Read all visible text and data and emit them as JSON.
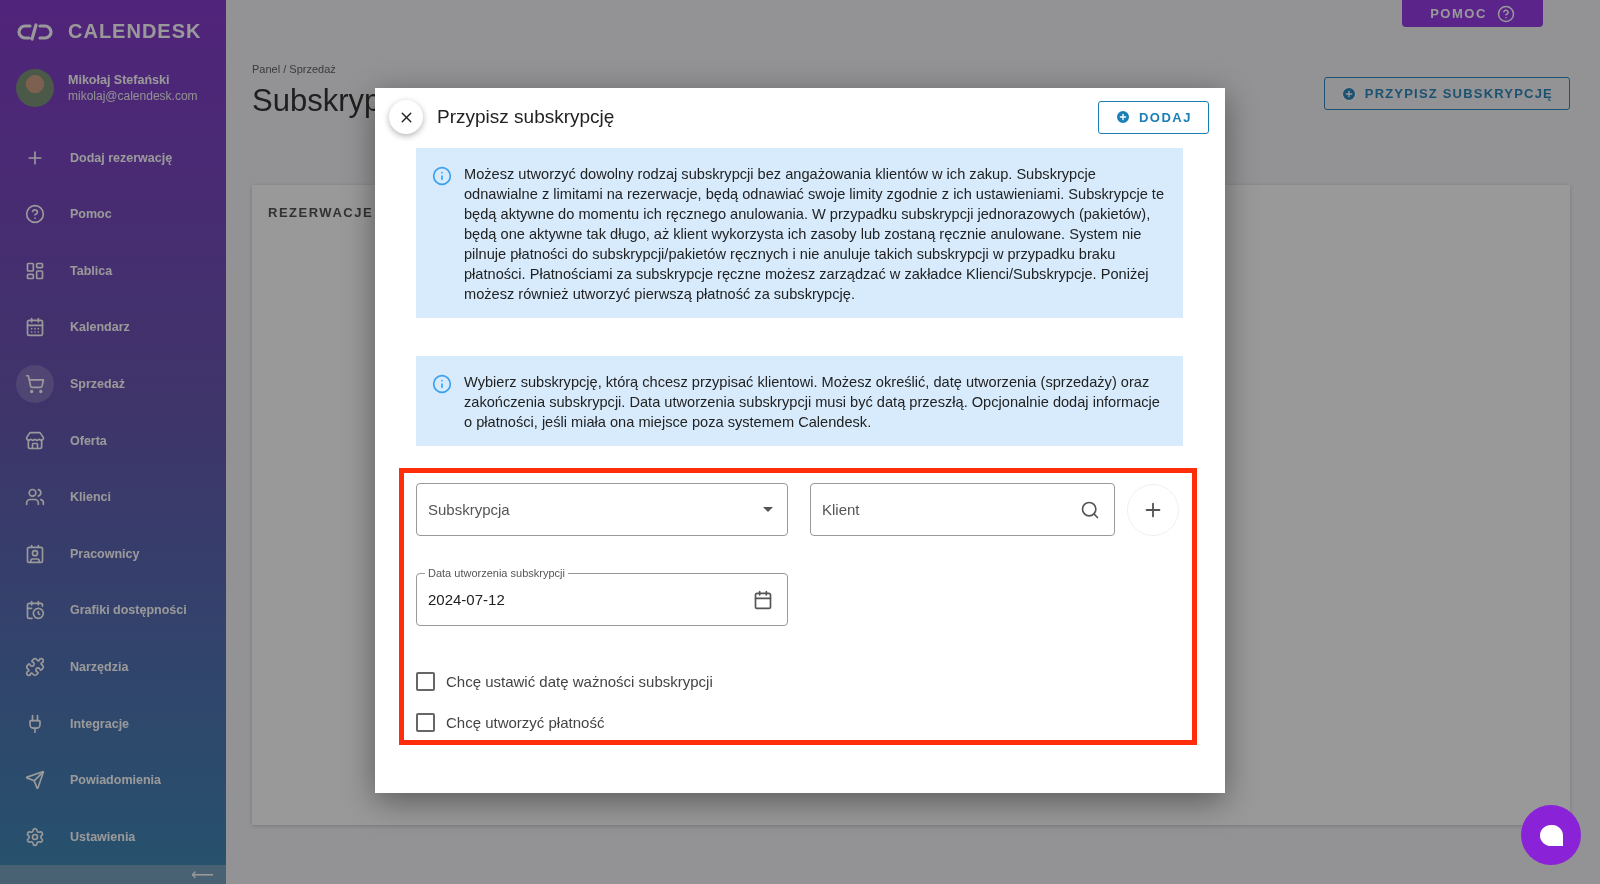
{
  "brand": "CALENDESK",
  "user": {
    "name": "Mikołaj Stefański",
    "email": "mikolaj@calendesk.com"
  },
  "sidebar": {
    "items": [
      {
        "label": "Dodaj rezerwację",
        "selected": false
      },
      {
        "label": "Pomoc",
        "selected": false
      },
      {
        "label": "Tablica",
        "selected": false
      },
      {
        "label": "Kalendarz",
        "selected": false
      },
      {
        "label": "Sprzedaż",
        "selected": true
      },
      {
        "label": "Oferta",
        "selected": false
      },
      {
        "label": "Klienci",
        "selected": false
      },
      {
        "label": "Pracownicy",
        "selected": false
      },
      {
        "label": "Grafiki dostępności",
        "selected": false
      },
      {
        "label": "Narzędzia",
        "selected": false
      },
      {
        "label": "Integracje",
        "selected": false
      },
      {
        "label": "Powiadomienia",
        "selected": false
      },
      {
        "label": "Ustawienia",
        "selected": false
      }
    ],
    "collapse": "⟵"
  },
  "help_button": "POMOC",
  "breadcrumb": "Panel / Sprzedaż",
  "page_title": "Subskryp",
  "assign_button": "PRZYPISZ SUBSKRYPCJĘ",
  "card_title": "REZERWACJE",
  "dialog": {
    "title": "Przypisz subskrypcję",
    "add_button": "DODAJ",
    "infos": [
      "Możesz utworzyć dowolny rodzaj subskrypcji bez angażowania klientów w ich zakup. Subskrypcje odnawialne z limitami na rezerwacje, będą odnawiać swoje limity zgodnie z ich ustawieniami. Subskrypcje te będą aktywne do momentu ich ręcznego anulowania. W przypadku subskrypcji jednorazowych (pakietów), będą one aktywne tak długo, aż klient wykorzysta ich zasoby lub zostaną ręcznie anulowane. System nie pilnuje płatności do subskrypcji/pakietów ręcznych i nie anuluje takich subskrypcji w przypadku braku płatności. Płatnościami za subskrypcje ręczne możesz zarządzać w zakładce Klienci/Subskrypcje. Poniżej możesz również utworzyć pierwszą płatność za subskrypcję.",
      "Wybierz subskrypcję, którą chcesz przypisać klientowi. Możesz określić, datę utworzenia (sprzedaży) oraz zakończenia subskrypcji. Data utworzenia subskrypcji musi być datą przeszłą. Opcjonalnie dodaj informacje o płatności, jeśli miała ona miejsce poza systemem Calendesk."
    ],
    "subscription": {
      "placeholder": "Subskrypcja"
    },
    "client": {
      "placeholder": "Klient"
    },
    "created_date": {
      "label": "Data utworzenia subskrypcji",
      "value": "2024-07-12"
    },
    "checkboxes": [
      {
        "label": "Chcę ustawić datę ważności subskrypcji",
        "checked": false
      },
      {
        "label": "Chcę utworzyć płatność",
        "checked": false
      }
    ]
  }
}
